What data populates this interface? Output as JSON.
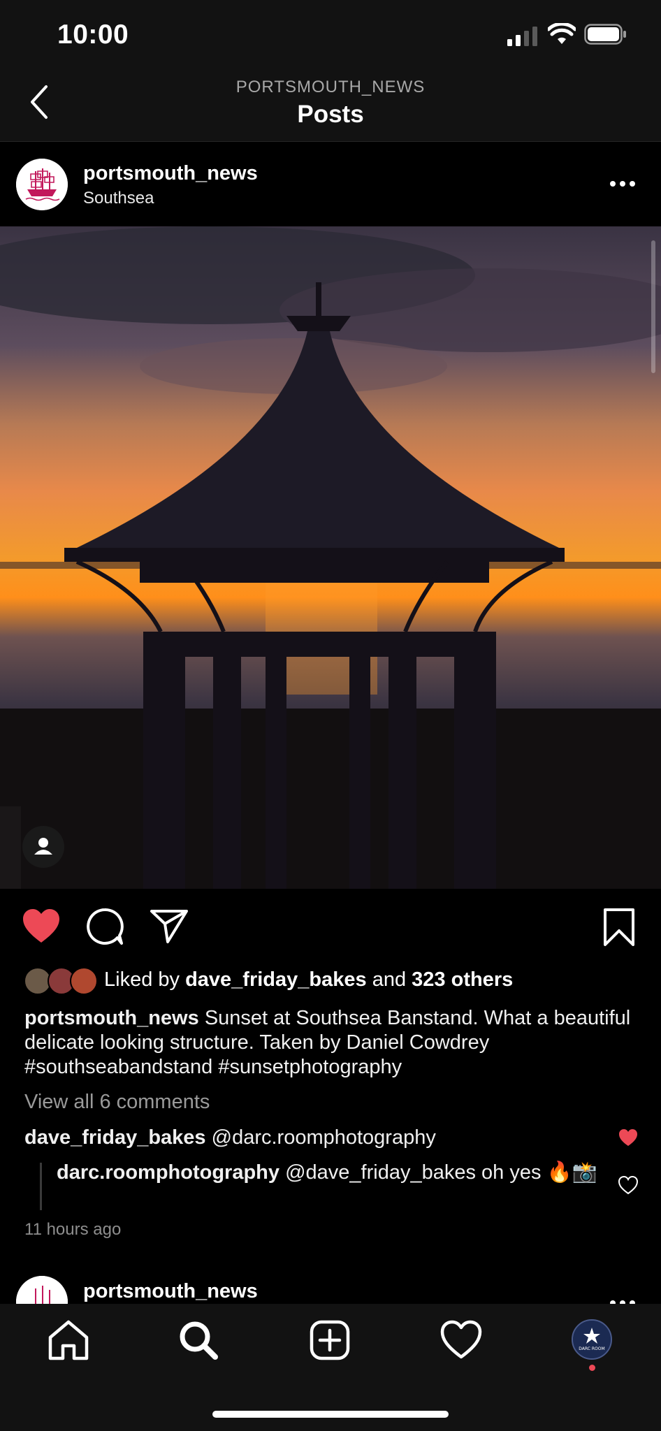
{
  "status_bar": {
    "time": "10:00"
  },
  "nav": {
    "subtitle": "PORTSMOUTH_NEWS",
    "title": "Posts"
  },
  "post": {
    "username": "portsmouth_news",
    "location": "Southsea",
    "liked": true,
    "likes": {
      "prefix": "Liked by",
      "user": "dave_friday_bakes",
      "and": "and",
      "others": "323 others"
    },
    "caption": {
      "username": "portsmouth_news",
      "text": "Sunset at Southsea Banstand. What a beautiful delicate looking structure. Taken by Daniel Cowdrey #southseabandstand #sunsetphotography"
    },
    "view_comments": "View all 6 comments",
    "comments": [
      {
        "username": "dave_friday_bakes",
        "text": "@darc.roomphotography",
        "liked": true
      },
      {
        "username": "darc.roomphotography",
        "text": "@dave_friday_bakes oh yes 🔥📸",
        "liked": false
      }
    ],
    "timestamp": "11 hours ago"
  },
  "next_post": {
    "username": "portsmouth_news"
  },
  "tabs": [
    {
      "name": "home",
      "icon": "home-icon"
    },
    {
      "name": "search",
      "icon": "search-icon"
    },
    {
      "name": "new-post",
      "icon": "plus-square-icon"
    },
    {
      "name": "activity",
      "icon": "heart-icon"
    },
    {
      "name": "profile",
      "icon": "profile-avatar",
      "text": "DARC ROOM"
    }
  ],
  "colors": {
    "like_red": "#ed4956",
    "background": "#000000",
    "bar_bg": "#121212",
    "muted_text": "#8e8e8e"
  }
}
